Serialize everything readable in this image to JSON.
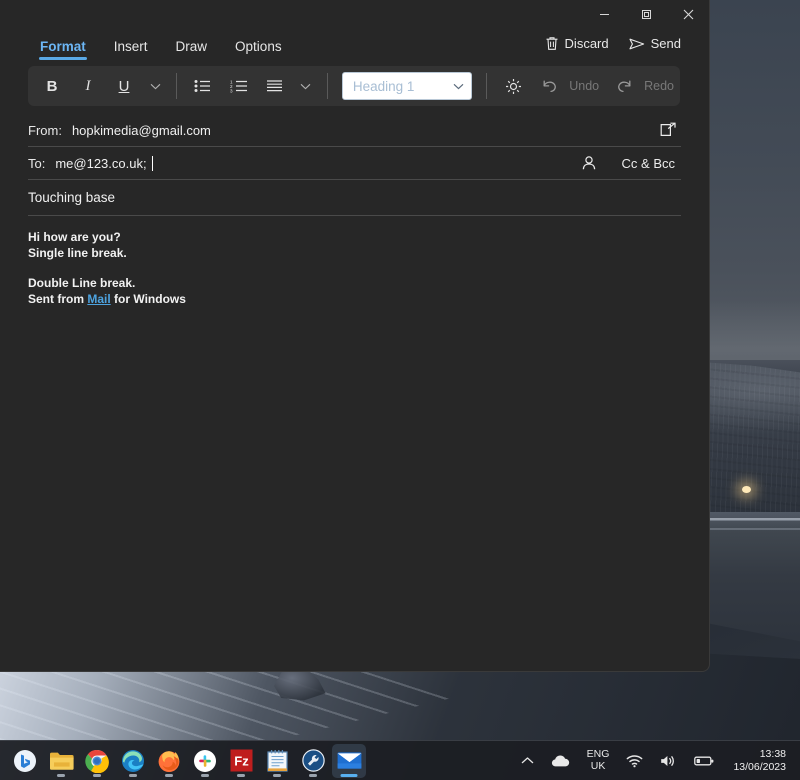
{
  "window": {
    "controls": {
      "minimize_label": "Minimize",
      "restore_label": "Restore",
      "close_label": "Close"
    }
  },
  "ribbon": {
    "tabs": [
      {
        "label": "Format",
        "active": true
      },
      {
        "label": "Insert",
        "active": false
      },
      {
        "label": "Draw",
        "active": false
      },
      {
        "label": "Options",
        "active": false
      }
    ],
    "actions": [
      {
        "label": "Discard",
        "icon": "trash-icon"
      },
      {
        "label": "Send",
        "icon": "send-icon"
      }
    ],
    "accent_color": "#5aa9e6"
  },
  "toolbar": {
    "bold_label": "B",
    "italic_label": "I",
    "underline_label": "U",
    "font_more_label": "∨",
    "bullet_list_label": "Bullets",
    "numbered_list_label": "Numbering",
    "align_label": "Alignment",
    "paragraph_more_label": "∨",
    "style_select_value": "Heading 1",
    "style_select_chevron": "∨",
    "styles_gear_label": "Styles",
    "undo_label": "Undo",
    "redo_label": "Redo"
  },
  "compose": {
    "from_label": "From:",
    "from_value": "hopkimedia@gmail.com",
    "popout_label": "Open in new window",
    "to_label": "To:",
    "to_value": "me@123.co.uk;",
    "contacts_label": "Choose contacts",
    "ccbcc_label": "Cc & Bcc",
    "subject_value": "Touching base",
    "body": {
      "line1": "Hi how are you?",
      "line2": "Single line break.",
      "line3": "Double Line break.",
      "signature_prefix": "Sent from ",
      "signature_link": "Mail",
      "signature_suffix": " for Windows"
    }
  },
  "taskbar": {
    "apps": [
      {
        "name": "copilot-bing",
        "label": "Bing Copilot",
        "active": false
      },
      {
        "name": "file-explorer",
        "label": "File Explorer",
        "active": false
      },
      {
        "name": "chrome",
        "label": "Google Chrome",
        "active": false
      },
      {
        "name": "edge",
        "label": "Microsoft Edge",
        "active": false
      },
      {
        "name": "firefox",
        "label": "Firefox",
        "active": false
      },
      {
        "name": "slack",
        "label": "Slack",
        "active": false
      },
      {
        "name": "filezilla",
        "label": "FileZilla",
        "active": false
      },
      {
        "name": "notepad",
        "label": "Notepad",
        "active": false
      },
      {
        "name": "tools",
        "label": "Tools",
        "active": false
      },
      {
        "name": "mail",
        "label": "Mail",
        "active": true
      }
    ],
    "tray": {
      "overflow_label": "Show hidden icons",
      "cloud_label": "OneDrive",
      "language_line1": "ENG",
      "language_line2": "UK",
      "wifi_label": "Network",
      "volume_label": "Volume",
      "battery_label": "Battery",
      "time": "13:38",
      "date": "13/06/2023"
    }
  }
}
